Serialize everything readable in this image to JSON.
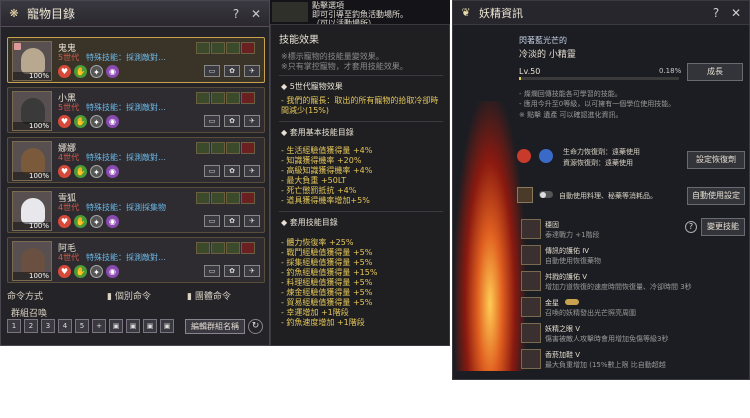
{
  "pet_panel": {
    "title": "寵物目錄",
    "help": "?",
    "close": "✕",
    "pets": [
      {
        "name": "鬼鬼",
        "gen": "5世代",
        "skill": "特殊技能：採測敵對…",
        "pct": "100%",
        "selected": true
      },
      {
        "name": "小黑",
        "gen": "5世代",
        "skill": "特殊技能：採測敵對…",
        "pct": "100%",
        "selected": false
      },
      {
        "name": "娜娜",
        "gen": "4世代",
        "skill": "特殊技能：採測敵對…",
        "pct": "100%",
        "selected": false
      },
      {
        "name": "雪狐",
        "gen": "4世代",
        "skill": "特殊技能：採測採集物",
        "pct": "100%",
        "selected": false
      },
      {
        "name": "阿毛",
        "gen": "4世代",
        "skill": "特殊技能：採測敵對…",
        "pct": "100%",
        "selected": false
      }
    ],
    "command_mode": "命令方式",
    "individual_cmd": "個別命令",
    "group_cmd": "團體命令",
    "group_summon": "群組召喚",
    "group_numbers": [
      "1",
      "2",
      "3",
      "4",
      "5"
    ],
    "rename": "編輯群組名稱"
  },
  "banner": {
    "line1": "點擊選項",
    "line2": "即可引導至釣魚活動場所。",
    "line3": "（可以活動場所）"
  },
  "tooltip": {
    "title": "技能效果",
    "note1": "※標示寵物的技能量變效果。",
    "note2": "※只有掌控寵物，才套用技能效果。",
    "sec1": "5世代寵物效果",
    "sec1_lines": [
      "- 我們的寵長：取出的所有寵物的拾取冷卻時",
      "  間減少(15%)"
    ],
    "sec2": "套用基本技能目錄",
    "sec2_lines": [
      "- 生活經驗值獲得量 +4%",
      "- 知識獲得機率 +20%",
      "- 高級知識獲得機率 +4%",
      "- 最大負重 +50LT",
      "- 死亡懲罰抵抗 +4%",
      "- 道具獲得機率增加+5%"
    ],
    "sec3": "套用技能目錄",
    "sec3_lines": [
      "- 體力恢復率 +25%",
      "- 戰鬥經驗值獲得量 +5%",
      "- 採集經驗值獲得量 +5%",
      "- 釣魚經驗值獲得量 +15%",
      "- 料理經驗值獲得量 +5%",
      "- 煉金經驗值獲得量 +5%",
      "- 貿易經驗值獲得量 +5%",
      "- 幸運增加 +1階段",
      "- 釣魚速度增加 +1階段"
    ]
  },
  "spirit_panel": {
    "title": "妖精資訊",
    "help": "?",
    "close": "✕",
    "subtitle": "閃著藍光芒的",
    "name": "冷淡的 小精靈",
    "level": "Lv.50",
    "exp": "0.18%",
    "grow_btn": "成長",
    "desc1": "- 燦爛回傳技能各可學習的技能。",
    "desc2": "- 應用今升至0等級，以可擁有一個學位使用技能。",
    "desc3": "※ 點擊 遺產 可以確認進化資訊。",
    "potion1": "生命力恢復劑：遠藥使用",
    "potion2": "資源恢復劑：遠藥使用",
    "potion_btn": "設定恢復劑",
    "auto_text": "自動使用料理、秘藥等消耗品。",
    "auto_btn": "自動使用設定",
    "change_btn": "變更技能",
    "skills": [
      {
        "name": "穩固",
        "desc": "泰達戰力 +1階段"
      },
      {
        "name": "傳訊的護佑 IV",
        "desc": "自動使用恢復藥物"
      },
      {
        "name": "舛戮的護佑 V",
        "desc": "增加力道恢復的速度時間恢復量、冷卻時間 3秒"
      },
      {
        "name": "金星",
        "desc": "召喚的妖精發出光芒照亮周圍"
      },
      {
        "name": "妖精之眼 V",
        "desc": "傷害被敵人攻擊時會用增加免傷等級3秒"
      },
      {
        "name": "香菸加鞋 V",
        "desc": "最大負重增加 (15%數上限 比自動超越"
      }
    ]
  }
}
